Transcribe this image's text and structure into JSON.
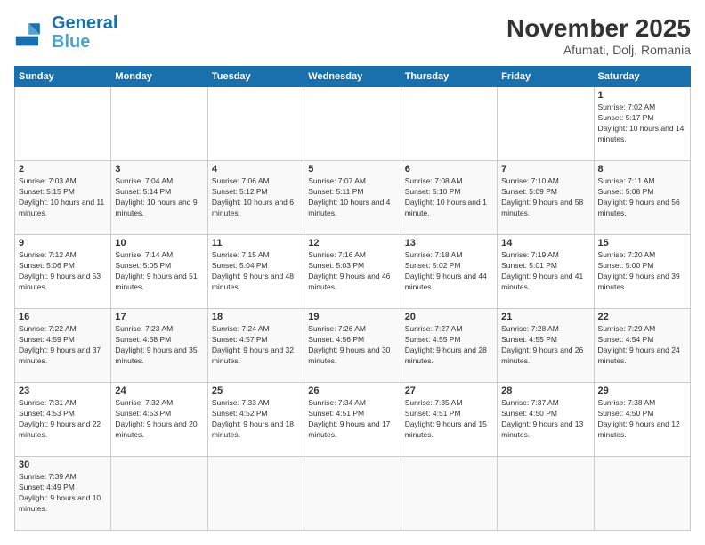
{
  "header": {
    "logo_general": "General",
    "logo_blue": "Blue",
    "month_year": "November 2025",
    "location": "Afumati, Dolj, Romania"
  },
  "weekdays": [
    "Sunday",
    "Monday",
    "Tuesday",
    "Wednesday",
    "Thursday",
    "Friday",
    "Saturday"
  ],
  "weeks": [
    [
      {
        "day": "",
        "info": ""
      },
      {
        "day": "",
        "info": ""
      },
      {
        "day": "",
        "info": ""
      },
      {
        "day": "",
        "info": ""
      },
      {
        "day": "",
        "info": ""
      },
      {
        "day": "",
        "info": ""
      },
      {
        "day": "1",
        "info": "Sunrise: 7:02 AM\nSunset: 5:17 PM\nDaylight: 10 hours and 14 minutes."
      }
    ],
    [
      {
        "day": "2",
        "info": "Sunrise: 7:03 AM\nSunset: 5:15 PM\nDaylight: 10 hours and 11 minutes."
      },
      {
        "day": "3",
        "info": "Sunrise: 7:04 AM\nSunset: 5:14 PM\nDaylight: 10 hours and 9 minutes."
      },
      {
        "day": "4",
        "info": "Sunrise: 7:06 AM\nSunset: 5:12 PM\nDaylight: 10 hours and 6 minutes."
      },
      {
        "day": "5",
        "info": "Sunrise: 7:07 AM\nSunset: 5:11 PM\nDaylight: 10 hours and 4 minutes."
      },
      {
        "day": "6",
        "info": "Sunrise: 7:08 AM\nSunset: 5:10 PM\nDaylight: 10 hours and 1 minute."
      },
      {
        "day": "7",
        "info": "Sunrise: 7:10 AM\nSunset: 5:09 PM\nDaylight: 9 hours and 58 minutes."
      },
      {
        "day": "8",
        "info": "Sunrise: 7:11 AM\nSunset: 5:08 PM\nDaylight: 9 hours and 56 minutes."
      }
    ],
    [
      {
        "day": "9",
        "info": "Sunrise: 7:12 AM\nSunset: 5:06 PM\nDaylight: 9 hours and 53 minutes."
      },
      {
        "day": "10",
        "info": "Sunrise: 7:14 AM\nSunset: 5:05 PM\nDaylight: 9 hours and 51 minutes."
      },
      {
        "day": "11",
        "info": "Sunrise: 7:15 AM\nSunset: 5:04 PM\nDaylight: 9 hours and 48 minutes."
      },
      {
        "day": "12",
        "info": "Sunrise: 7:16 AM\nSunset: 5:03 PM\nDaylight: 9 hours and 46 minutes."
      },
      {
        "day": "13",
        "info": "Sunrise: 7:18 AM\nSunset: 5:02 PM\nDaylight: 9 hours and 44 minutes."
      },
      {
        "day": "14",
        "info": "Sunrise: 7:19 AM\nSunset: 5:01 PM\nDaylight: 9 hours and 41 minutes."
      },
      {
        "day": "15",
        "info": "Sunrise: 7:20 AM\nSunset: 5:00 PM\nDaylight: 9 hours and 39 minutes."
      }
    ],
    [
      {
        "day": "16",
        "info": "Sunrise: 7:22 AM\nSunset: 4:59 PM\nDaylight: 9 hours and 37 minutes."
      },
      {
        "day": "17",
        "info": "Sunrise: 7:23 AM\nSunset: 4:58 PM\nDaylight: 9 hours and 35 minutes."
      },
      {
        "day": "18",
        "info": "Sunrise: 7:24 AM\nSunset: 4:57 PM\nDaylight: 9 hours and 32 minutes."
      },
      {
        "day": "19",
        "info": "Sunrise: 7:26 AM\nSunset: 4:56 PM\nDaylight: 9 hours and 30 minutes."
      },
      {
        "day": "20",
        "info": "Sunrise: 7:27 AM\nSunset: 4:55 PM\nDaylight: 9 hours and 28 minutes."
      },
      {
        "day": "21",
        "info": "Sunrise: 7:28 AM\nSunset: 4:55 PM\nDaylight: 9 hours and 26 minutes."
      },
      {
        "day": "22",
        "info": "Sunrise: 7:29 AM\nSunset: 4:54 PM\nDaylight: 9 hours and 24 minutes."
      }
    ],
    [
      {
        "day": "23",
        "info": "Sunrise: 7:31 AM\nSunset: 4:53 PM\nDaylight: 9 hours and 22 minutes."
      },
      {
        "day": "24",
        "info": "Sunrise: 7:32 AM\nSunset: 4:53 PM\nDaylight: 9 hours and 20 minutes."
      },
      {
        "day": "25",
        "info": "Sunrise: 7:33 AM\nSunset: 4:52 PM\nDaylight: 9 hours and 18 minutes."
      },
      {
        "day": "26",
        "info": "Sunrise: 7:34 AM\nSunset: 4:51 PM\nDaylight: 9 hours and 17 minutes."
      },
      {
        "day": "27",
        "info": "Sunrise: 7:35 AM\nSunset: 4:51 PM\nDaylight: 9 hours and 15 minutes."
      },
      {
        "day": "28",
        "info": "Sunrise: 7:37 AM\nSunset: 4:50 PM\nDaylight: 9 hours and 13 minutes."
      },
      {
        "day": "29",
        "info": "Sunrise: 7:38 AM\nSunset: 4:50 PM\nDaylight: 9 hours and 12 minutes."
      }
    ],
    [
      {
        "day": "30",
        "info": "Sunrise: 7:39 AM\nSunset: 4:49 PM\nDaylight: 9 hours and 10 minutes."
      },
      {
        "day": "",
        "info": ""
      },
      {
        "day": "",
        "info": ""
      },
      {
        "day": "",
        "info": ""
      },
      {
        "day": "",
        "info": ""
      },
      {
        "day": "",
        "info": ""
      },
      {
        "day": "",
        "info": ""
      }
    ]
  ]
}
